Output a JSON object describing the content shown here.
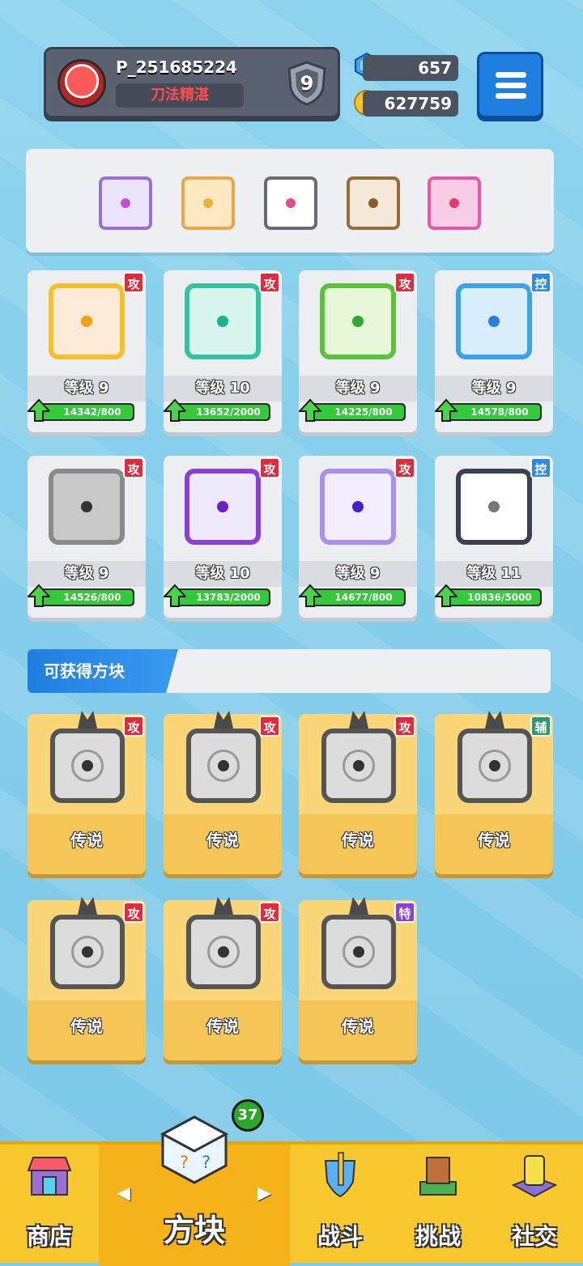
{
  "player": {
    "name": "P_251685224",
    "title": "刀法精湛",
    "rank_level": "9"
  },
  "currency": {
    "gems": "657",
    "gold": "627759"
  },
  "equipped": [
    {
      "name": "purple-dragon-dice",
      "border": "#9b6fd6",
      "fill": "#ece4fb",
      "dot": "#c24fd6"
    },
    {
      "name": "fire-dice",
      "border": "#e8a84a",
      "fill": "#fde8c2",
      "dot": "#e8b240"
    },
    {
      "name": "rainbow-dragon-dice",
      "border": "#6b6b6b",
      "fill": "#ffffff",
      "dot": "#e84a8a"
    },
    {
      "name": "mystery-dice",
      "border": "#9a6a3a",
      "fill": "#f4e9d8",
      "dot": "#8a5a2a"
    },
    {
      "name": "pink-dragon-dice",
      "border": "#e35aa8",
      "fill": "#f8cce4",
      "dot": "#e8386f"
    }
  ],
  "cards": [
    {
      "name": "light-dice",
      "tag": "攻",
      "tag_color": "red",
      "border": "#f4c12a",
      "fill": "#fdebd8",
      "dot": "#f4a012",
      "level_label": "等级 9",
      "progress_text": "14342/800",
      "progress": 1.0
    },
    {
      "name": "wind-dice",
      "tag": "攻",
      "tag_color": "red",
      "border": "#35c2a2",
      "fill": "#d9f6ee",
      "dot": "#17b48f",
      "level_label": "等级 10",
      "progress_text": "13652/2000",
      "progress": 1.0
    },
    {
      "name": "poison-dice",
      "tag": "攻",
      "tag_color": "red",
      "border": "#5cc23a",
      "fill": "#e6f8d8",
      "dot": "#2faa2f",
      "level_label": "等级 9",
      "progress_text": "14225/800",
      "progress": 1.0
    },
    {
      "name": "ice-dice",
      "tag": "控",
      "tag_color": "blue",
      "border": "#3ca2ea",
      "fill": "#d8eefc",
      "dot": "#2a7ee0",
      "level_label": "等级 9",
      "progress_text": "14578/800",
      "progress": 1.0
    },
    {
      "name": "iron-dice",
      "tag": "攻",
      "tag_color": "red",
      "border": "#8a8a8a",
      "fill": "#c9c9c9",
      "dot": "#333333",
      "level_label": "等级 9",
      "progress_text": "14526/800",
      "progress": 1.0
    },
    {
      "name": "teleport-dice",
      "tag": "攻",
      "tag_color": "red",
      "border": "#8a3fd8",
      "fill": "#f0e8fb",
      "dot": "#6a1fc8",
      "level_label": "等级 10",
      "progress_text": "13783/2000",
      "progress": 1.0
    },
    {
      "name": "random-dice",
      "tag": "攻",
      "tag_color": "red",
      "border": "#a88ff0",
      "fill": "#f2eefd",
      "dot": "#4a1fc8",
      "level_label": "等级 9",
      "progress_text": "14677/800",
      "progress": 1.0
    },
    {
      "name": "lock-dice",
      "tag": "控",
      "tag_color": "blue",
      "border": "#3a4150",
      "fill": "#ffffff",
      "dot": "#777777",
      "level_label": "等级 11",
      "progress_text": "10836/5000",
      "progress": 1.0
    }
  ],
  "available_section": {
    "title": "可获得方块"
  },
  "legend_cards": [
    {
      "name": "legend-dice-1",
      "tag": "攻",
      "tag_color": "red",
      "rarity": "传说"
    },
    {
      "name": "legend-dice-2",
      "tag": "攻",
      "tag_color": "red",
      "rarity": "传说"
    },
    {
      "name": "legend-dice-3",
      "tag": "攻",
      "tag_color": "red",
      "rarity": "传说"
    },
    {
      "name": "legend-dice-4",
      "tag": "辅",
      "tag_color": "green",
      "rarity": "传说"
    },
    {
      "name": "legend-dice-5",
      "tag": "攻",
      "tag_color": "red",
      "rarity": "传说"
    },
    {
      "name": "legend-dice-6",
      "tag": "攻",
      "tag_color": "red",
      "rarity": "传说"
    },
    {
      "name": "legend-dice-7",
      "tag": "特",
      "tag_color": "purple",
      "rarity": "传说"
    }
  ],
  "nav": {
    "badge": "37",
    "items": [
      {
        "label": "商店",
        "icon": "shop-icon"
      },
      {
        "label": "方块",
        "icon": "dice-icon",
        "active": true
      },
      {
        "label": "战斗",
        "icon": "battle-icon"
      },
      {
        "label": "挑战",
        "icon": "challenge-icon"
      },
      {
        "label": "社交",
        "icon": "social-icon"
      }
    ]
  },
  "colors": {
    "accent_blue": "#1f7fe0",
    "nav_yellow": "#f9c82f",
    "attack_tag": "#e8283a",
    "control_tag": "#2a8be8"
  }
}
